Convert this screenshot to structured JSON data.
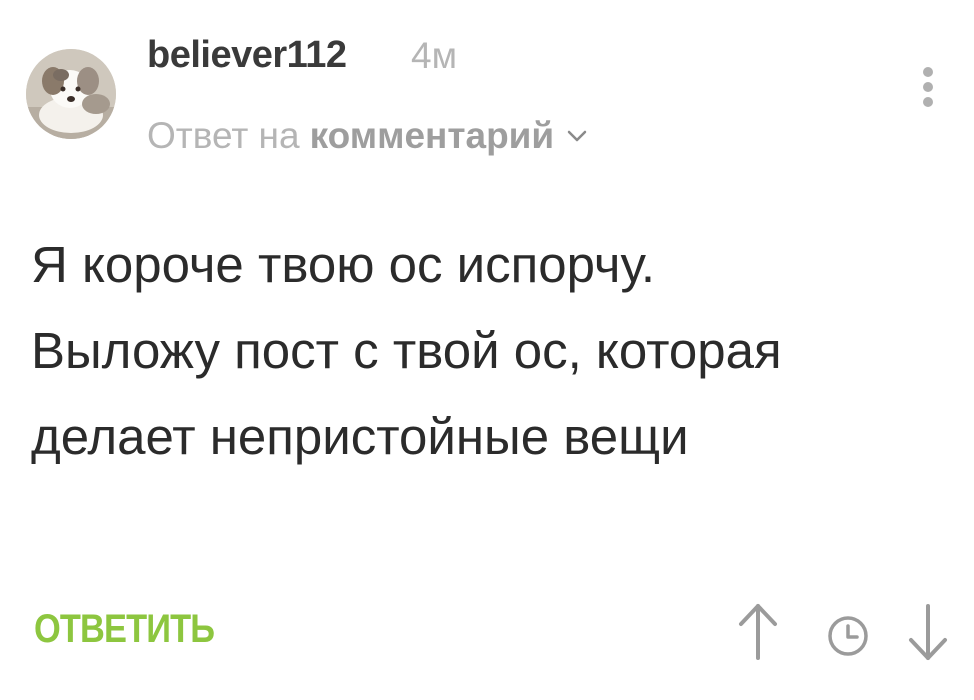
{
  "comment": {
    "author": "believer112",
    "time_ago": "4м",
    "reply_prefix": "Ответ на",
    "reply_target": "комментарий",
    "text": "Я короче твою ос испорчу. Выложу пост с твой ос, которая делает непристойные вещи",
    "reply_button": "ОТВЕТИТЬ"
  },
  "icons": {
    "avatar": "avatar-dog-photo",
    "reply_chevron": "chevron-down-icon",
    "more": "more-vertical-icon",
    "up": "arrow-up-icon",
    "clock": "clock-icon",
    "down": "arrow-down-icon"
  },
  "colors": {
    "accent": "#8dc63f",
    "author": "#3a3a3a",
    "muted": "#b5b5b5",
    "text": "#2b2b2b"
  }
}
